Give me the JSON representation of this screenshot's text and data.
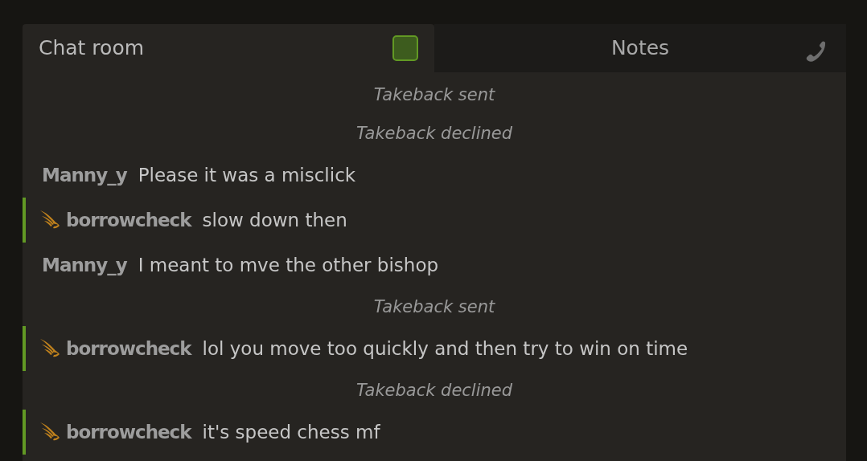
{
  "tabs": [
    {
      "label": "Chat room",
      "selected": true,
      "toggle": {
        "on": true
      }
    },
    {
      "label": "Notes",
      "selected": false
    }
  ],
  "messages": [
    {
      "kind": "system",
      "text": "Takeback sent"
    },
    {
      "kind": "system",
      "text": "Takeback declined"
    },
    {
      "kind": "message",
      "user": "Manny_y",
      "patron": false,
      "text": "Please it was a misclick"
    },
    {
      "kind": "message",
      "user": "borrowcheck",
      "patron": true,
      "text": "slow down then"
    },
    {
      "kind": "message",
      "user": "Manny_y",
      "patron": false,
      "text": "I meant to mve the other bishop"
    },
    {
      "kind": "system",
      "text": "Takeback sent"
    },
    {
      "kind": "message",
      "user": "borrowcheck",
      "patron": true,
      "text": "lol you move too quickly and then try to win on time"
    },
    {
      "kind": "system",
      "text": "Takeback declined"
    },
    {
      "kind": "message",
      "user": "borrowcheck",
      "patron": true,
      "text": "it's speed chess mf"
    }
  ]
}
